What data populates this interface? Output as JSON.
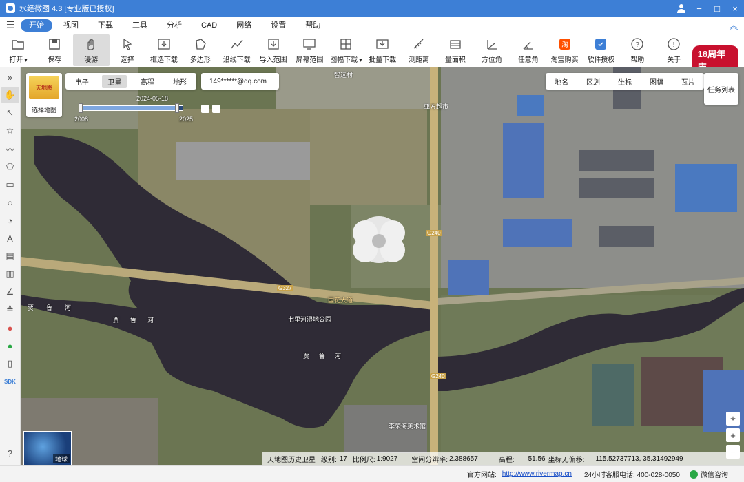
{
  "window": {
    "title": "水经微图 4.3 [专业版已授权]"
  },
  "menu": {
    "tabs": [
      "开始",
      "视图",
      "下载",
      "工具",
      "分析",
      "CAD",
      "网络",
      "设置",
      "帮助"
    ],
    "active": "开始"
  },
  "toolbar": {
    "items": [
      {
        "label": "打开",
        "icon": "folder-icon",
        "dropdown": true
      },
      {
        "label": "保存",
        "icon": "save-icon"
      },
      {
        "label": "漫游",
        "icon": "hand-icon",
        "active": true
      },
      {
        "label": "选择",
        "icon": "cursor-icon"
      },
      {
        "label": "框选下载",
        "icon": "box-download-icon"
      },
      {
        "label": "多边形",
        "icon": "polygon-icon"
      },
      {
        "label": "沿线下载",
        "icon": "line-download-icon"
      },
      {
        "label": "导入范围",
        "icon": "import-range-icon"
      },
      {
        "label": "屏幕范围",
        "icon": "screen-range-icon"
      },
      {
        "label": "图幅下载",
        "icon": "sheet-download-icon",
        "dropdown": true
      },
      {
        "label": "批量下载",
        "icon": "batch-download-icon"
      },
      {
        "label": "测距离",
        "icon": "measure-distance-icon"
      },
      {
        "label": "量面积",
        "icon": "measure-area-icon"
      },
      {
        "label": "方位角",
        "icon": "azimuth-icon"
      },
      {
        "label": "任意角",
        "icon": "angle-icon"
      },
      {
        "label": "淘宝购买",
        "icon": "taobao-icon"
      },
      {
        "label": "软件授权",
        "icon": "license-icon"
      },
      {
        "label": "帮助",
        "icon": "help-icon"
      },
      {
        "label": "关于",
        "icon": "info-icon"
      }
    ],
    "anniversary": "18周年庆"
  },
  "map": {
    "logo_caption": "选择地图",
    "logo_text": "天地图",
    "map_types": [
      "电子",
      "卫星",
      "高程",
      "地形"
    ],
    "active_type": "卫星",
    "account": "149******@qq.com",
    "layers": [
      "地名",
      "区划",
      "坐标",
      "图幅",
      "瓦片"
    ],
    "task_list": "任务列表",
    "timeline": {
      "date": "2024-05-18",
      "start": "2008",
      "end": "2025",
      "progress": 0.94
    },
    "globe_label": "地球",
    "labels": {
      "village": "智远村",
      "supermarket": "亚方超市",
      "road": "国花大道",
      "river": "贾鲁河",
      "park": "七里河湿地公园",
      "museum": "李荣海美术馆",
      "g327": "G327",
      "g240": "G240"
    },
    "status": {
      "source": "天地图历史卫星",
      "level_label": "级别:",
      "level": "17",
      "scale_label": "比例尺:",
      "scale": "1:9027",
      "resolution_label": "空间分辨率:",
      "resolution": "2.388657",
      "elevation_label": "高程:",
      "elevation": "51.56",
      "coord_label": "坐标无偏移:",
      "coord": "115.52737713, 35.31492949"
    }
  },
  "footer": {
    "site_label": "官方网站:",
    "url": "http://www.rivermap.cn",
    "phone": "24小时客服电话: 400-028-0050",
    "wechat": "微信咨询"
  },
  "colors": {
    "accent": "#3d7fd6",
    "anniversary": "#c8102e"
  }
}
